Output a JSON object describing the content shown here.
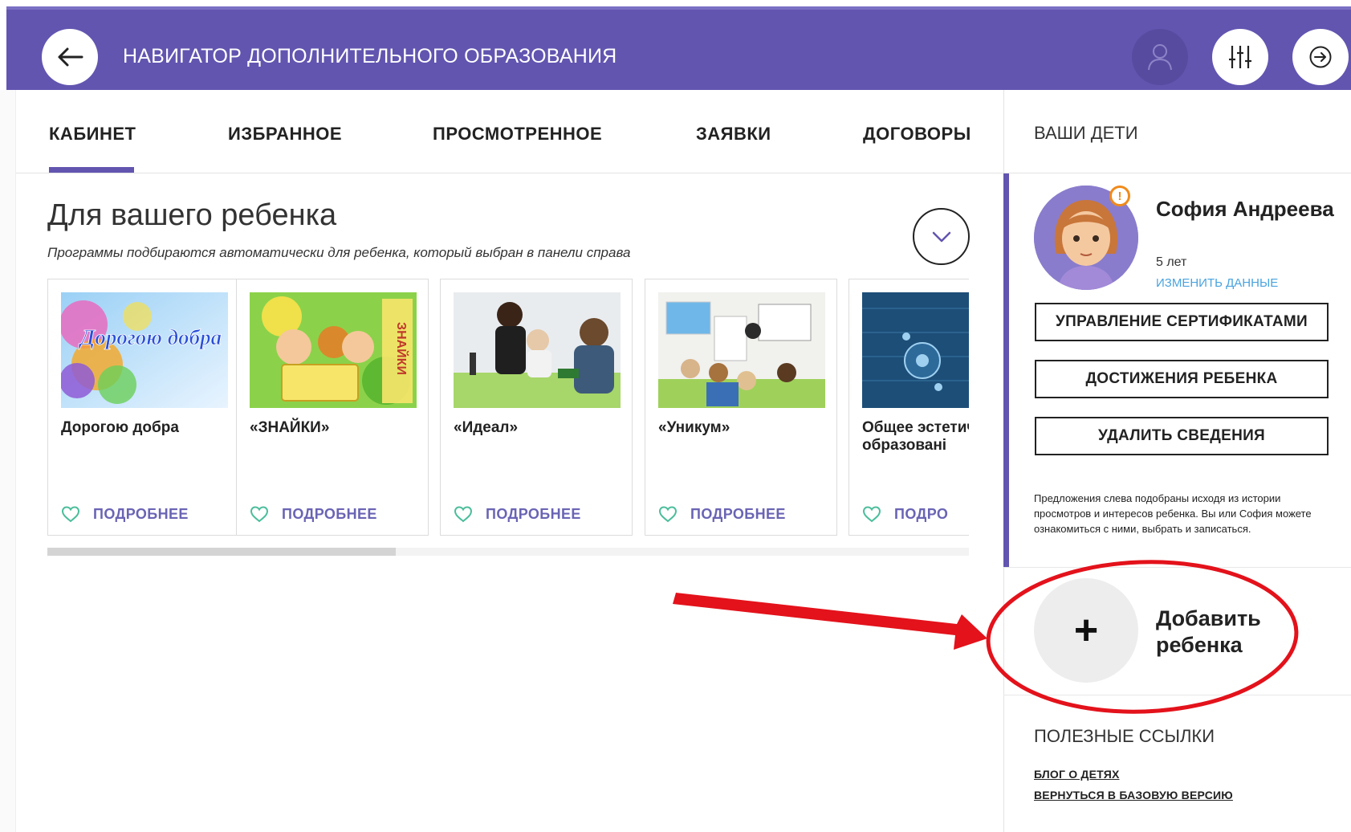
{
  "header": {
    "title": "НАВИГАТОР ДОПОЛНИТЕЛЬНОГО ОБРАЗОВАНИЯ",
    "icons": [
      "arrow-left-icon",
      "user-icon",
      "filter-sliders-icon",
      "exit-icon"
    ]
  },
  "tabs": [
    {
      "label": "КАБИНЕТ",
      "active": true
    },
    {
      "label": "ИЗБРАННОЕ",
      "active": false
    },
    {
      "label": "ПРОСМОТРЕННОЕ",
      "active": false
    },
    {
      "label": "ЗАЯВКИ",
      "active": false
    },
    {
      "label": "ДОГОВОРЫ",
      "active": false
    }
  ],
  "main": {
    "title": "Для вашего ребенка",
    "subtitle": "Программы подбираются автоматически для ребенка, который выбран в панели справа",
    "cards": [
      {
        "title": "Дорогою добра",
        "image_text": "Дорогою добра",
        "more": "ПОДРОБНЕЕ"
      },
      {
        "title": "«ЗНАЙКИ»",
        "image_text": "ЗНАЙКИ",
        "more": "ПОДРОБНЕЕ"
      },
      {
        "title": "«Идеал»",
        "more": "ПОДРОБНЕЕ"
      },
      {
        "title": "«Уникум»",
        "more": "ПОДРОБНЕЕ"
      },
      {
        "title": "Общее эстетическ образовані",
        "more": "ПОДРО"
      }
    ]
  },
  "right_panel": {
    "heading": "ВАШИ ДЕТИ",
    "child": {
      "name": "София Андреева",
      "age": "5 лет",
      "edit_link": "ИЗМЕНИТЬ ДАННЫЕ",
      "warning_badge": "!"
    },
    "buttons": [
      "УПРАВЛЕНИЕ СЕРТИФИКАТАМИ",
      "ДОСТИЖЕНИЯ РЕБЕНКА",
      "УДАЛИТЬ СВЕДЕНИЯ"
    ],
    "note": "Предложения слева подобраны исходя из истории просмотров и интересов ребенка. Вы или София можете ознакомиться с ними, выбрать и записаться.",
    "add_child": {
      "icon": "+",
      "label": "Добавить ребенка"
    },
    "links_heading": "ПОЛЕЗНЫЕ ССЫЛКИ",
    "links": [
      "БЛОГ О ДЕТЯХ",
      "ВЕРНУТЬСЯ В БАЗОВУЮ ВЕРСИЮ"
    ]
  },
  "colors": {
    "header_bg": "#6255b0",
    "accent": "#6255b0",
    "link": "#4aa3df",
    "more_link": "#6a64b4",
    "annotation": "#e3121b"
  }
}
